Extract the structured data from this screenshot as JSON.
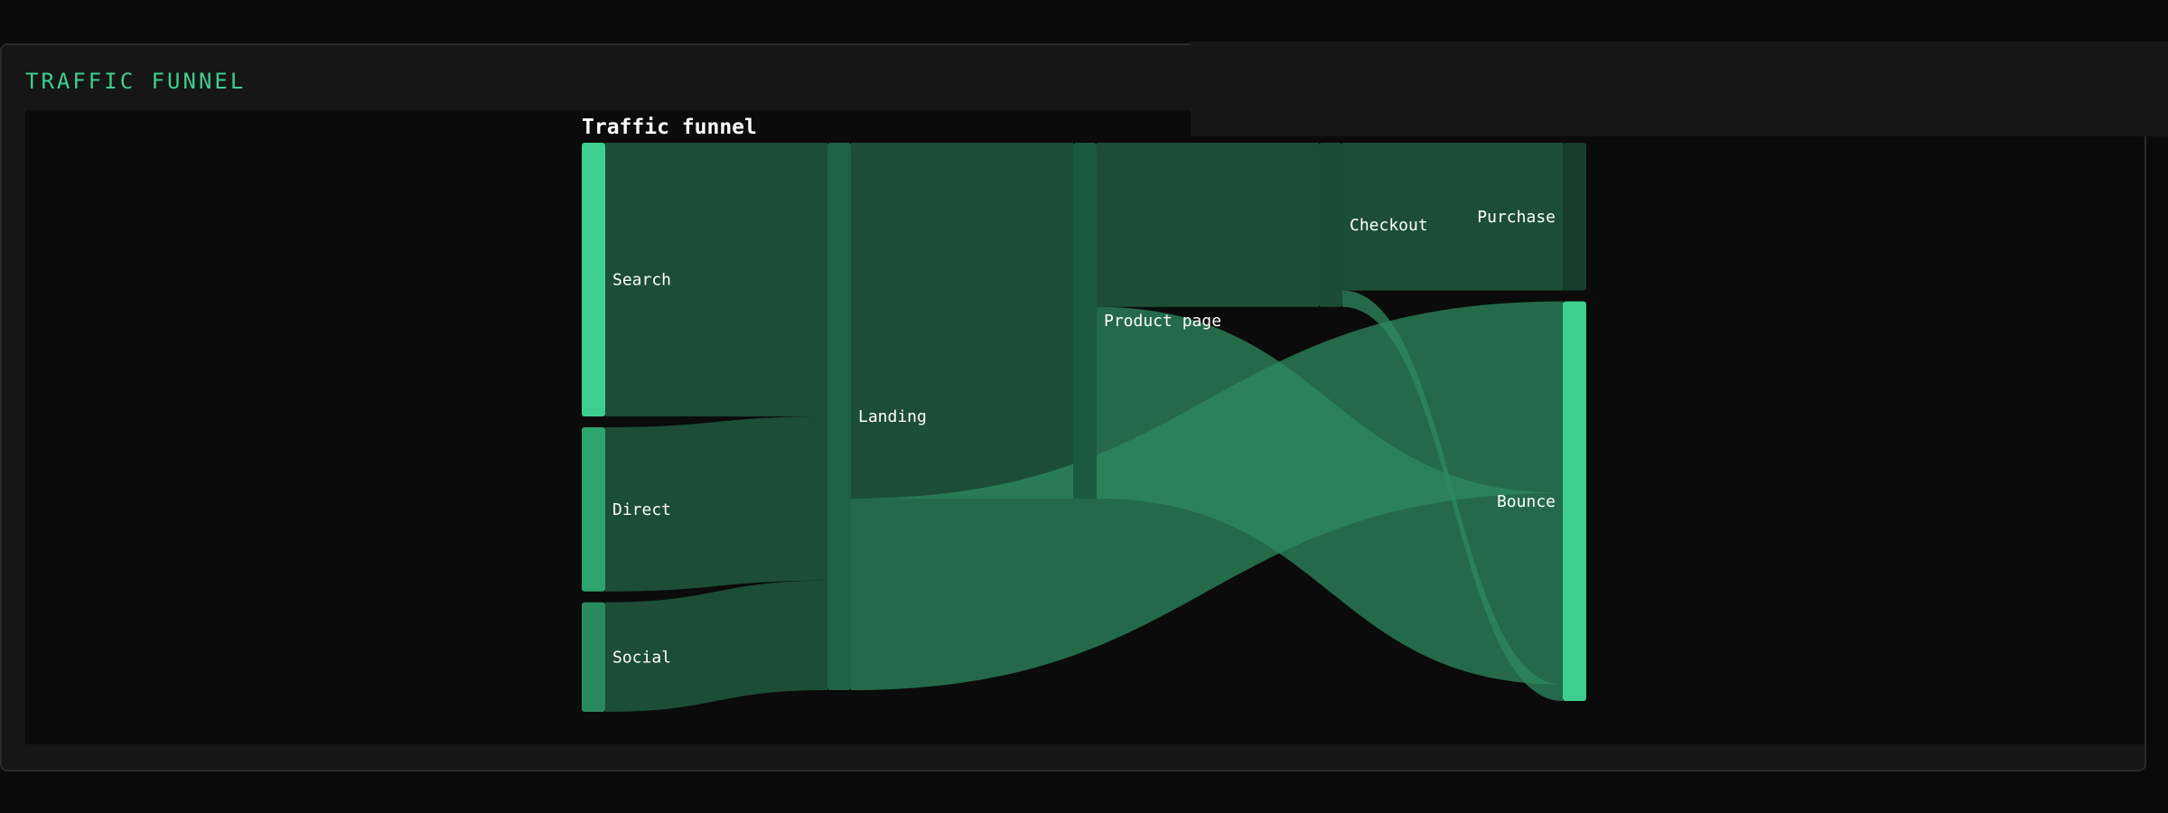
{
  "panel": {
    "header": "TRAFFIC FUNNEL"
  },
  "colors": {
    "background": "#0a0a0a",
    "panel": "#161616",
    "accent": "#3ecf8e",
    "link_dark": "#1c4d37",
    "link_light": "#2e8b60"
  },
  "chart_data": {
    "type": "sankey",
    "title": "Traffic funnel",
    "nodes": [
      {
        "id": "Search",
        "label": "Search",
        "column": 0
      },
      {
        "id": "Direct",
        "label": "Direct",
        "column": 0
      },
      {
        "id": "Social",
        "label": "Social",
        "column": 0
      },
      {
        "id": "Landing",
        "label": "Landing",
        "column": 1
      },
      {
        "id": "Product page",
        "label": "Product page",
        "column": 2
      },
      {
        "id": "Checkout",
        "label": "Checkout",
        "column": 3
      },
      {
        "id": "Purchase",
        "label": "Purchase",
        "column": 4
      },
      {
        "id": "Bounce",
        "label": "Bounce",
        "column": 4
      }
    ],
    "links": [
      {
        "source": "Search",
        "target": "Landing",
        "value": 5000
      },
      {
        "source": "Direct",
        "target": "Landing",
        "value": 3000
      },
      {
        "source": "Social",
        "target": "Landing",
        "value": 2000
      },
      {
        "source": "Landing",
        "target": "Product page",
        "value": 6500
      },
      {
        "source": "Landing",
        "target": "Bounce",
        "value": 3500
      },
      {
        "source": "Product page",
        "target": "Checkout",
        "value": 3000
      },
      {
        "source": "Product page",
        "target": "Bounce",
        "value": 3500
      },
      {
        "source": "Checkout",
        "target": "Purchase",
        "value": 2700
      },
      {
        "source": "Checkout",
        "target": "Bounce",
        "value": 300
      }
    ]
  }
}
